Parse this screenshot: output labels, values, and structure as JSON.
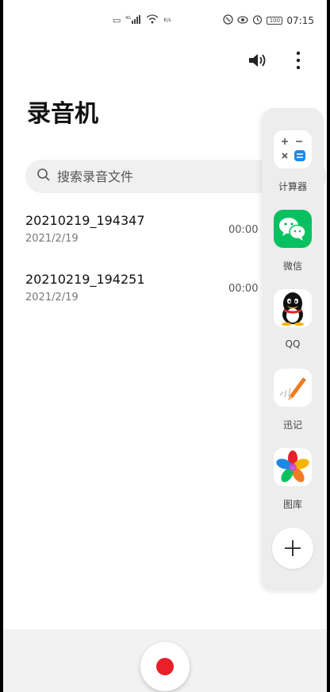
{
  "status_bar": {
    "net_label": "4G",
    "speed": "K/s",
    "battery": "100",
    "time": "07:15"
  },
  "app": {
    "title": "录音机"
  },
  "search": {
    "placeholder": "搜索录音文件"
  },
  "recordings": [
    {
      "name": "20210219_194347",
      "date": "2021/2/19",
      "duration": "00:00"
    },
    {
      "name": "20210219_194251",
      "date": "2021/2/19",
      "duration": "00:00"
    }
  ],
  "dock": {
    "apps": [
      {
        "label": "计算器",
        "icon": "calculator-icon"
      },
      {
        "label": "微信",
        "icon": "wechat-icon"
      },
      {
        "label": "QQ",
        "icon": "qq-icon"
      },
      {
        "label": "迅记",
        "icon": "notes-icon"
      },
      {
        "label": "图库",
        "icon": "gallery-icon"
      }
    ]
  },
  "colors": {
    "accent_blue": "#1e88e5",
    "wechat_green": "#07c160",
    "record_red": "#e8202a",
    "notes_orange": "#f07b22"
  }
}
